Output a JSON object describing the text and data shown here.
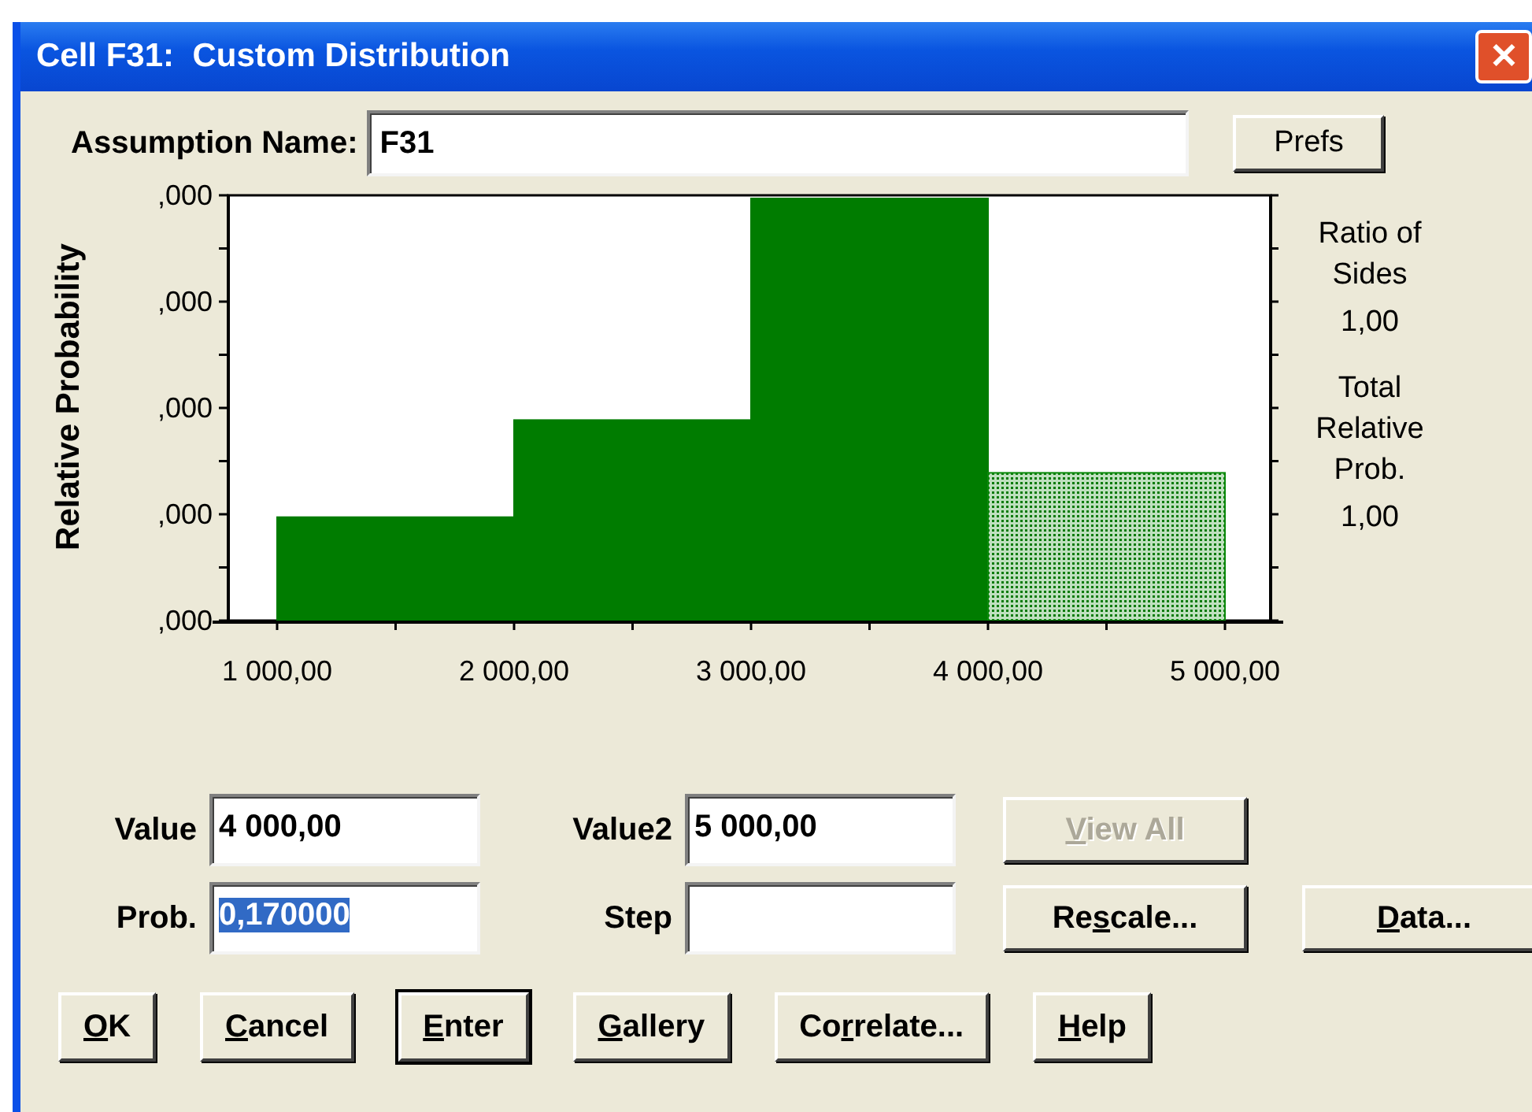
{
  "window": {
    "title": "Cell F31:  Custom Distribution",
    "close": "✕"
  },
  "assumption_name": {
    "label": "Assumption Name:",
    "value": "F31"
  },
  "prefs_button": "Prefs",
  "chart": {
    "ylabel": "Relative Probability",
    "yticks": [
      ",000",
      ",000",
      ",000",
      ",000",
      ",000"
    ],
    "xticks": [
      "1 000,00",
      "2 000,00",
      "3 000,00",
      "4 000,00",
      "5 000,00"
    ],
    "bars": [
      {
        "selected": false
      },
      {
        "selected": false
      },
      {
        "selected": false
      },
      {
        "selected": true
      }
    ]
  },
  "side_info": [
    {
      "label": "Ratio of Sides",
      "value": "1,00"
    },
    {
      "label": "Total Relative Prob.",
      "value": "1,00"
    }
  ],
  "fields": [
    {
      "label": "Value",
      "value": "4 000,00"
    },
    {
      "label": "Value2",
      "value": "5 000,00"
    },
    {
      "label": "Prob.",
      "value": "0,170000",
      "value_selected": true
    },
    {
      "label": "Step"
    }
  ],
  "side_buttons": [
    {
      "segments": [
        {
          "text": "V",
          "underlined": true
        },
        {
          "text": "iew All",
          "underlined": false
        }
      ],
      "disabled": true
    },
    {
      "segments": [
        {
          "text": "Re",
          "underlined": false
        },
        {
          "text": "s",
          "underlined": true
        },
        {
          "text": "cale...",
          "underlined": false
        }
      ],
      "disabled": false
    },
    {
      "segments": [
        {
          "text": "D",
          "underlined": true
        },
        {
          "text": "ata...",
          "underlined": false
        }
      ],
      "disabled": false
    }
  ],
  "buttons": [
    {
      "segments": [
        {
          "text": "O",
          "underlined": true
        },
        {
          "text": "K",
          "underlined": false
        }
      ],
      "default": false
    },
    {
      "segments": [
        {
          "text": "C",
          "underlined": true
        },
        {
          "text": "ancel",
          "underlined": false
        }
      ],
      "default": false
    },
    {
      "segments": [
        {
          "text": "E",
          "underlined": true
        },
        {
          "text": "nter",
          "underlined": false
        }
      ],
      "default": true
    },
    {
      "segments": [
        {
          "text": "G",
          "underlined": true
        },
        {
          "text": "allery",
          "underlined": false
        }
      ],
      "default": false
    },
    {
      "segments": [
        {
          "text": "Co",
          "underlined": false
        },
        {
          "text": "r",
          "underlined": true
        },
        {
          "text": "relate...",
          "underlined": false
        }
      ],
      "default": false
    },
    {
      "segments": [
        {
          "text": "H",
          "underlined": true
        },
        {
          "text": "elp",
          "underlined": false
        }
      ],
      "default": false
    }
  ]
}
